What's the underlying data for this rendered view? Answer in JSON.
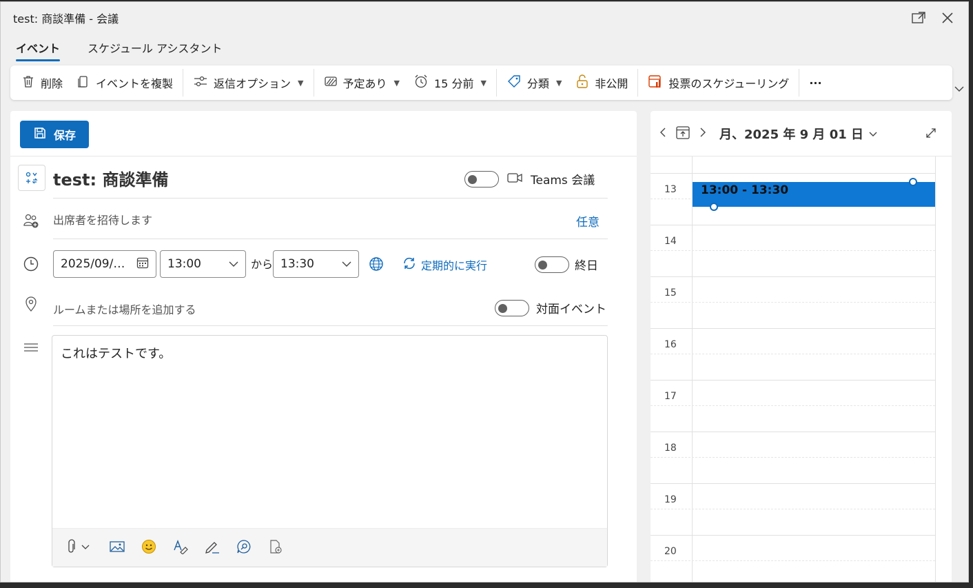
{
  "window": {
    "title": "test: 商談準備 - 会議"
  },
  "tabs": [
    {
      "label": "イベント"
    },
    {
      "label": "スケジュール アシスタント"
    }
  ],
  "ribbon": {
    "delete": "削除",
    "duplicate": "イベントを複製",
    "response_options": "返信オプション",
    "show_as": "予定あり",
    "reminder": "15 分前",
    "categorize": "分類",
    "private": "非公開",
    "poll": "投票のスケジューリング",
    "more": "···"
  },
  "form": {
    "save_label": "保存",
    "title": "test: 商談準備",
    "teams_label": "Teams 会議",
    "attendees_placeholder": "出席者を招待します",
    "optional_link": "任意",
    "date_value": "2025/09/…",
    "start_time": "13:00",
    "from_label": "から",
    "end_time": "13:30",
    "recurrence_label": "定期的に実行",
    "all_day_label": "終日",
    "location_placeholder": "ルームまたは場所を追加する",
    "in_person_label": "対面イベント",
    "body_text": "これはテストです。"
  },
  "calendar": {
    "date_label": "月、2025 年 9 月 01 日",
    "hours": [
      "13",
      "14",
      "15",
      "16",
      "17",
      "18",
      "19",
      "20"
    ],
    "event_time": "13:00 - 13:30"
  },
  "colors": {
    "accent": "#0f6cbd",
    "event": "#0f78d4"
  }
}
